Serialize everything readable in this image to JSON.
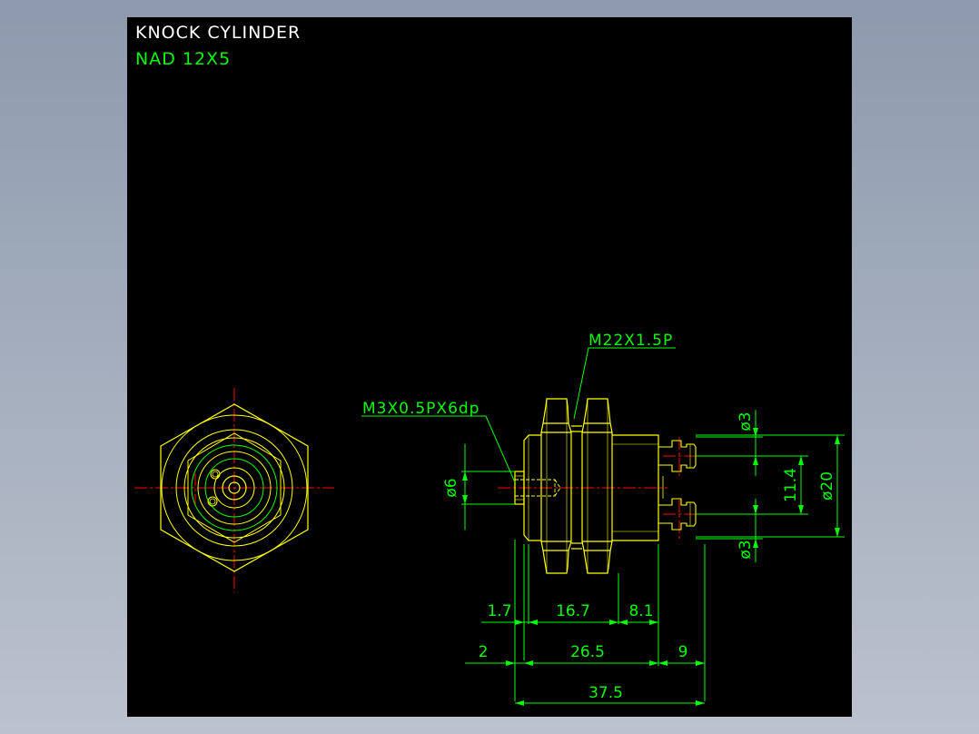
{
  "title": {
    "line1": "KNOCK CYLINDER",
    "line2": "NAD 12X5"
  },
  "callouts": {
    "thread_main": "M22X1.5P",
    "thread_tap": "M3X0.5PX6dp"
  },
  "dimensions": {
    "d_phi6": "ø6",
    "d_phi3_top": "ø3",
    "d_phi3_bottom": "ø3",
    "d_11_4": "11.4",
    "d_phi20": "ø20",
    "d_1_7": "1.7",
    "d_16_7": "16.7",
    "d_8_1": "8.1",
    "d_2": "2",
    "d_26_5": "26.5",
    "d_9": "9",
    "d_37_5": "37.5"
  },
  "colors": {
    "background": "#000000",
    "outline": "#ffff00",
    "dimension": "#00ff00",
    "centerline": "#ff0000",
    "title": "#ffffff"
  }
}
